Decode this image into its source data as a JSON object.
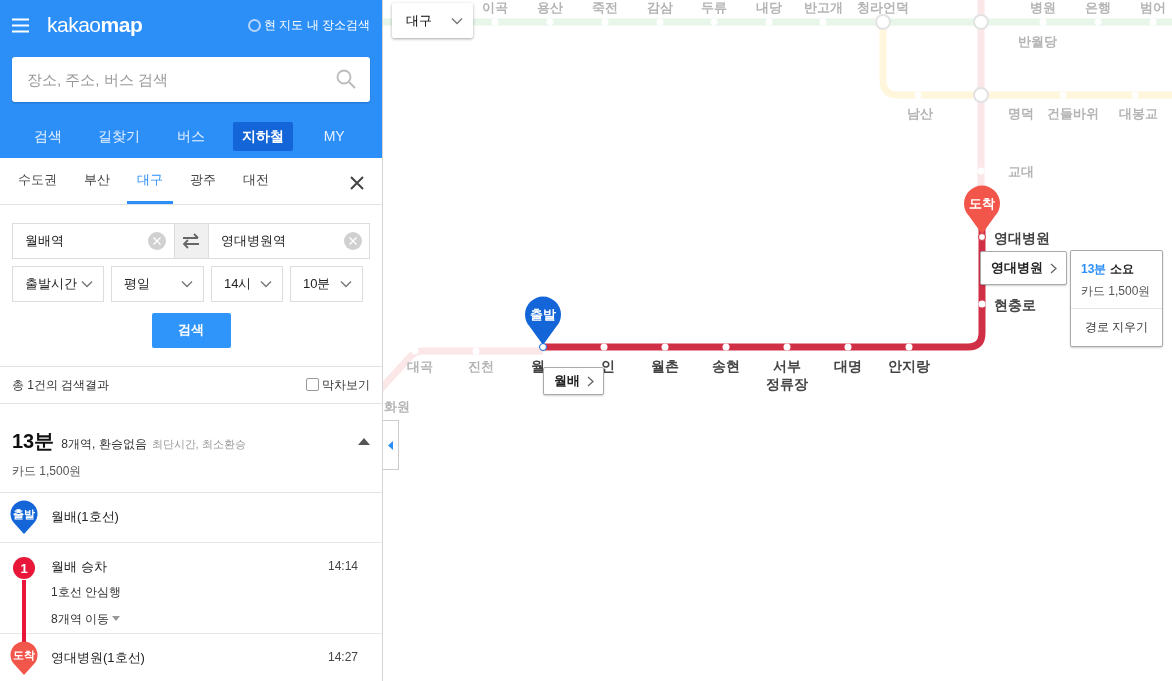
{
  "header": {
    "logo_light": "kakao",
    "logo_bold": "map",
    "map_area_search": {
      "label": "현 지도 내 장소검색",
      "checked": false
    },
    "search": {
      "placeholder": "장소, 주소, 버스 검색"
    }
  },
  "main_tabs": [
    {
      "label": "검색",
      "selected": false
    },
    {
      "label": "길찾기",
      "selected": false
    },
    {
      "label": "버스",
      "selected": false
    },
    {
      "label": "지하철",
      "selected": true
    },
    {
      "label": "MY",
      "selected": false
    }
  ],
  "region_tabs": [
    {
      "label": "수도권",
      "selected": false
    },
    {
      "label": "부산",
      "selected": false
    },
    {
      "label": "대구",
      "selected": true
    },
    {
      "label": "광주",
      "selected": false
    },
    {
      "label": "대전",
      "selected": false
    }
  ],
  "route_form": {
    "origin": "월배역",
    "destination": "영대병원역",
    "selects": [
      "출발시간",
      "평일",
      "14시",
      "10분"
    ],
    "search_button": "검색"
  },
  "results": {
    "count_text": "총 1건의 검색결과",
    "last_train": {
      "label": "막차보기",
      "checked": false
    }
  },
  "summary": {
    "duration": "13분",
    "detail": "8개역, 환승없음",
    "tags": "최단시간, 최소환승",
    "fare": "카드 1,500원",
    "expanded": true
  },
  "steps": [
    {
      "kind": "start",
      "badge": "출발",
      "name": "월배(1호선)"
    },
    {
      "kind": "ride",
      "badge": "1",
      "name": "월배 승차",
      "time": "14:14",
      "direction": "1호선 안심행",
      "stops": "8개역 이동"
    },
    {
      "kind": "end",
      "badge": "도착",
      "name": "영대병원(1호선)",
      "time": "14:27"
    }
  ],
  "map": {
    "city_select": "대구",
    "background_labels": [
      "이곡",
      "용산",
      "죽전",
      "감삼",
      "두류",
      "내당",
      "반고개",
      "청라언덕",
      "병원",
      "은행",
      "범어",
      "반월당",
      "남산",
      "명덕",
      "건들바위",
      "대봉교",
      "교대",
      "대곡",
      "진천",
      "화원"
    ],
    "route_stations": [
      "월",
      "인",
      "월촌",
      "송현",
      "서부 정류장",
      "대명",
      "안지랑"
    ],
    "side_stations": [
      "영대병원",
      "현충로"
    ],
    "start_pin": "출발",
    "end_pin": "도착",
    "start_label": "월배",
    "end_label": "영대병원",
    "popup": {
      "duration": "13분",
      "duration_suffix": "소요",
      "fare": "카드 1,500원",
      "clear_button": "경로 지우기"
    }
  }
}
